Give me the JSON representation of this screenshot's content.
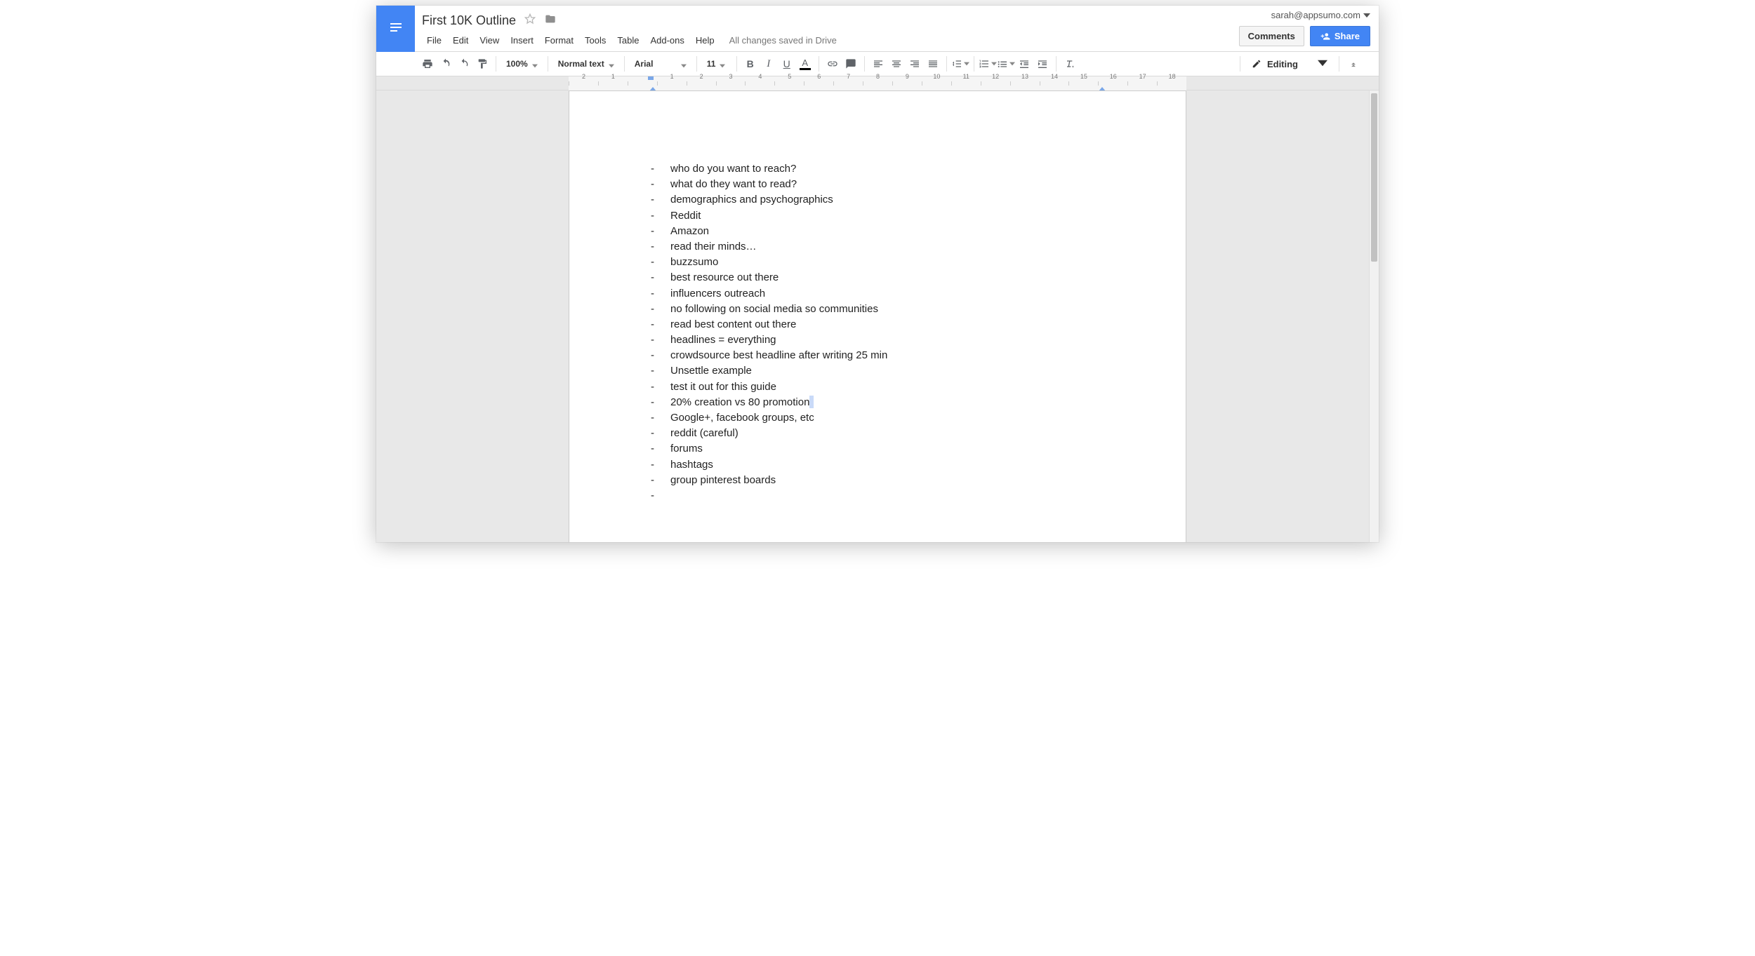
{
  "doc": {
    "title": "First 10K Outline"
  },
  "account": {
    "email": "sarah@appsumo.com"
  },
  "header": {
    "comments_label": "Comments",
    "share_label": "Share",
    "save_status": "All changes saved in Drive"
  },
  "menubar": {
    "items": [
      "File",
      "Edit",
      "View",
      "Insert",
      "Format",
      "Tools",
      "Table",
      "Add-ons",
      "Help"
    ]
  },
  "toolbar": {
    "zoom": "100%",
    "style": "Normal text",
    "font": "Arial",
    "size": "11",
    "mode_label": "Editing"
  },
  "ruler": {
    "labels": [
      "2",
      "1",
      "",
      "1",
      "2",
      "3",
      "4",
      "5",
      "6",
      "7",
      "8",
      "9",
      "10",
      "11",
      "12",
      "13",
      "14",
      "15",
      "16",
      "17",
      "18"
    ]
  },
  "content": {
    "lines": [
      "who do you want to reach?",
      "what do they want to read?",
      "demographics and psychographics",
      "Reddit",
      "Amazon",
      "read their minds…",
      "buzzsumo",
      "best resource out there",
      "influencers outreach",
      "no following on social media so communities",
      "read best content out there",
      "headlines  = everything",
      "crowdsource best headline after writing 25 min",
      "Unsettle example",
      "test it out for this guide",
      "20% creation vs 80 promotion",
      "Google+, facebook groups, etc",
      "reddit (careful)",
      "forums",
      "hashtags",
      "group pinterest boards",
      ""
    ],
    "cursor_after_line_index": 15
  }
}
